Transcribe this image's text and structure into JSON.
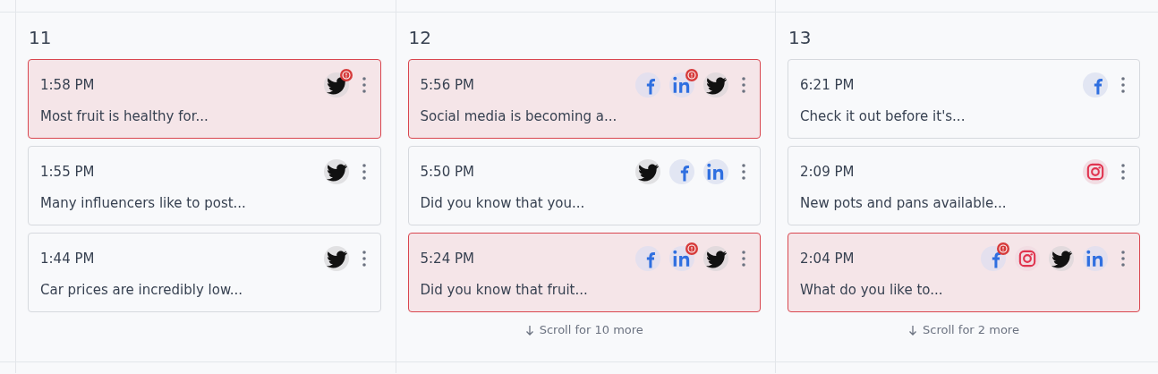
{
  "days": [
    {
      "day": "11",
      "posts": [
        {
          "time": "1:58 PM",
          "text": "Most fruit is healthy for...",
          "failed": true,
          "networks": [
            {
              "kind": "twitter",
              "error": true
            }
          ]
        },
        {
          "time": "1:55 PM",
          "text": "Many influencers like to post...",
          "failed": false,
          "networks": [
            {
              "kind": "twitter",
              "error": false
            }
          ]
        },
        {
          "time": "1:44 PM",
          "text": "Car prices are incredibly low...",
          "failed": false,
          "networks": [
            {
              "kind": "twitter",
              "error": false
            }
          ]
        }
      ]
    },
    {
      "day": "12",
      "posts": [
        {
          "time": "5:56 PM",
          "text": "Social media is becoming a...",
          "failed": true,
          "networks": [
            {
              "kind": "facebook",
              "error": false
            },
            {
              "kind": "linkedin",
              "error": true
            },
            {
              "kind": "twitter",
              "error": false
            }
          ]
        },
        {
          "time": "5:50 PM",
          "text": "Did you know that you...",
          "failed": false,
          "networks": [
            {
              "kind": "twitter",
              "error": false
            },
            {
              "kind": "facebook",
              "error": false
            },
            {
              "kind": "linkedin",
              "error": false
            }
          ]
        },
        {
          "time": "5:24 PM",
          "text": "Did you know that fruit...",
          "failed": true,
          "networks": [
            {
              "kind": "facebook",
              "error": false
            },
            {
              "kind": "linkedin",
              "error": true
            },
            {
              "kind": "twitter",
              "error": false
            }
          ]
        }
      ],
      "more": "Scroll for 10 more"
    },
    {
      "day": "13",
      "posts": [
        {
          "time": "6:21 PM",
          "text": "Check it out before it's...",
          "failed": false,
          "networks": [
            {
              "kind": "facebook",
              "error": false
            }
          ]
        },
        {
          "time": "2:09 PM",
          "text": "New pots and pans available...",
          "failed": false,
          "networks": [
            {
              "kind": "instagram",
              "error": false
            }
          ]
        },
        {
          "time": "2:04 PM",
          "text": "What do you like to...",
          "failed": true,
          "networks": [
            {
              "kind": "facebook",
              "error": true
            },
            {
              "kind": "instagram",
              "error": false
            },
            {
              "kind": "twitter",
              "error": false
            },
            {
              "kind": "linkedin",
              "error": false
            }
          ]
        }
      ],
      "more": "Scroll for 2 more"
    }
  ]
}
